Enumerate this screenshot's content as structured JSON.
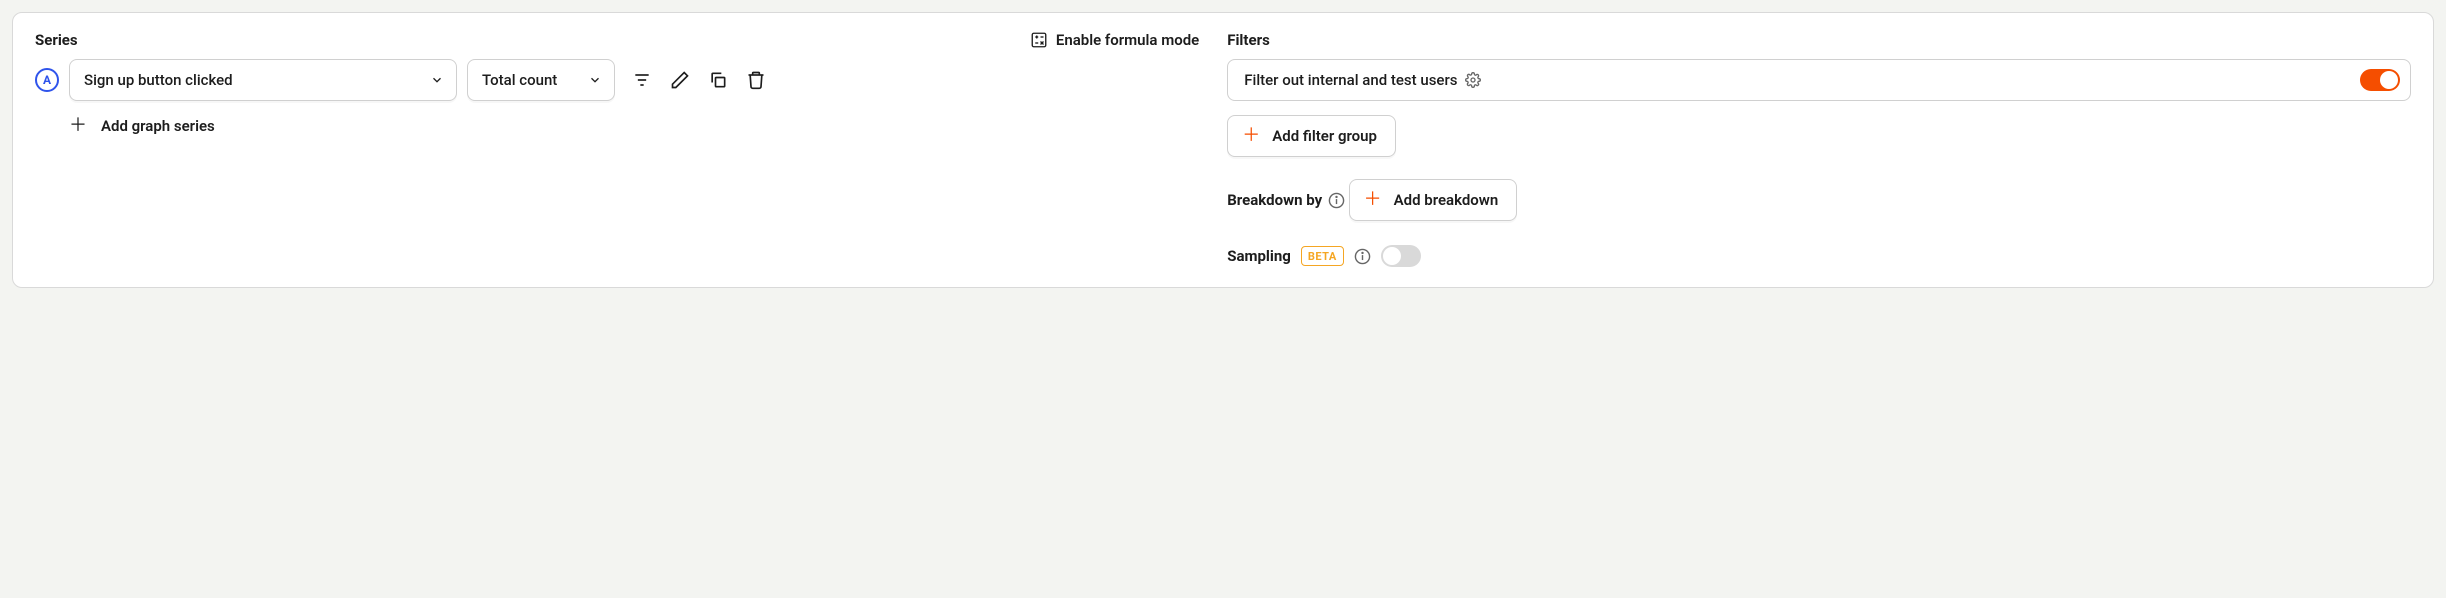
{
  "series": {
    "title": "Series",
    "formula_toggle_label": "Enable formula mode",
    "items": [
      {
        "badge": "A",
        "event": "Sign up button clicked",
        "aggregation": "Total count"
      }
    ],
    "add_label": "Add graph series"
  },
  "filters": {
    "title": "Filters",
    "active": {
      "label": "Filter out internal and test users",
      "enabled": true
    },
    "add_label": "Add filter group"
  },
  "breakdown": {
    "title": "Breakdown by",
    "add_label": "Add breakdown"
  },
  "sampling": {
    "title": "Sampling",
    "tag": "BETA",
    "enabled": false
  }
}
